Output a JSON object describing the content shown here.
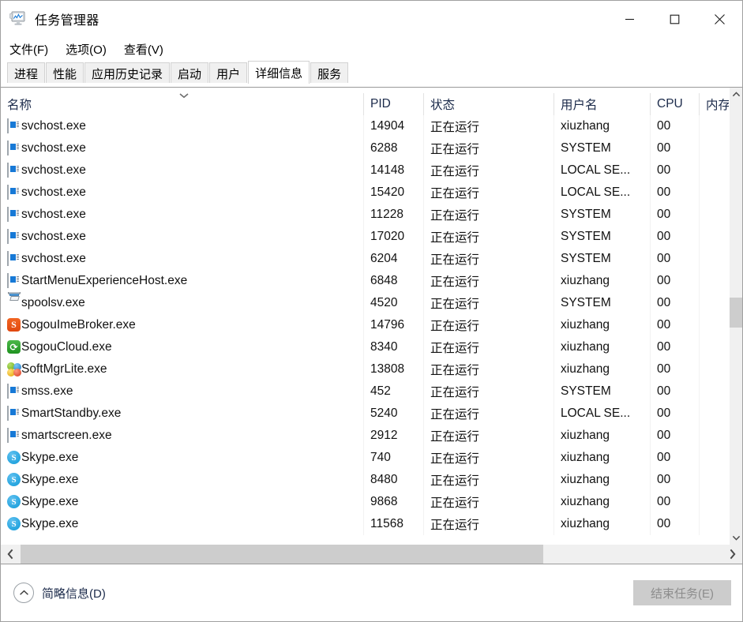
{
  "window": {
    "title": "任务管理器",
    "icon": "task-manager-icon",
    "minimize": "—",
    "maximize": "▢",
    "close": "✕"
  },
  "menu": {
    "items": [
      {
        "label": "文件(F)",
        "accel": "F"
      },
      {
        "label": "选项(O)",
        "accel": "O"
      },
      {
        "label": "查看(V)",
        "accel": "V"
      }
    ]
  },
  "tabs": {
    "active": "详细信息",
    "items": [
      {
        "label": "进程"
      },
      {
        "label": "性能"
      },
      {
        "label": "应用历史记录"
      },
      {
        "label": "启动"
      },
      {
        "label": "用户"
      },
      {
        "label": "详细信息"
      },
      {
        "label": "服务"
      }
    ]
  },
  "table": {
    "sort_column": "名称",
    "sort_direction": "descending",
    "sort_indicator": "chevron-down",
    "columns": [
      {
        "key": "name",
        "label": "名称"
      },
      {
        "key": "pid",
        "label": "PID"
      },
      {
        "key": "status",
        "label": "状态"
      },
      {
        "key": "user",
        "label": "用户名"
      },
      {
        "key": "cpu",
        "label": "CPU"
      },
      {
        "key": "mem",
        "label": "内存"
      }
    ],
    "rows": [
      {
        "icon": "generic-app-icon",
        "name": "svchost.exe",
        "pid": "14904",
        "status": "正在运行",
        "user": "xiuzhang",
        "cpu": "00",
        "mem": ""
      },
      {
        "icon": "generic-app-icon",
        "name": "svchost.exe",
        "pid": "6288",
        "status": "正在运行",
        "user": "SYSTEM",
        "cpu": "00",
        "mem": ""
      },
      {
        "icon": "generic-app-icon",
        "name": "svchost.exe",
        "pid": "14148",
        "status": "正在运行",
        "user": "LOCAL SE...",
        "cpu": "00",
        "mem": ""
      },
      {
        "icon": "generic-app-icon",
        "name": "svchost.exe",
        "pid": "15420",
        "status": "正在运行",
        "user": "LOCAL SE...",
        "cpu": "00",
        "mem": ""
      },
      {
        "icon": "generic-app-icon",
        "name": "svchost.exe",
        "pid": "11228",
        "status": "正在运行",
        "user": "SYSTEM",
        "cpu": "00",
        "mem": ""
      },
      {
        "icon": "generic-app-icon",
        "name": "svchost.exe",
        "pid": "17020",
        "status": "正在运行",
        "user": "SYSTEM",
        "cpu": "00",
        "mem": ""
      },
      {
        "icon": "generic-app-icon",
        "name": "svchost.exe",
        "pid": "6204",
        "status": "正在运行",
        "user": "SYSTEM",
        "cpu": "00",
        "mem": ""
      },
      {
        "icon": "generic-app-icon",
        "name": "StartMenuExperienceHost.exe",
        "pid": "6848",
        "status": "正在运行",
        "user": "xiuzhang",
        "cpu": "00",
        "mem": ""
      },
      {
        "icon": "printer-icon",
        "name": "spoolsv.exe",
        "pid": "4520",
        "status": "正在运行",
        "user": "SYSTEM",
        "cpu": "00",
        "mem": ""
      },
      {
        "icon": "sogou-ime-icon",
        "name": "SogouImeBroker.exe",
        "pid": "14796",
        "status": "正在运行",
        "user": "xiuzhang",
        "cpu": "00",
        "mem": ""
      },
      {
        "icon": "sogou-cloud-icon",
        "name": "SogouCloud.exe",
        "pid": "8340",
        "status": "正在运行",
        "user": "xiuzhang",
        "cpu": "00",
        "mem": ""
      },
      {
        "icon": "soft-mgr-icon",
        "name": "SoftMgrLite.exe",
        "pid": "13808",
        "status": "正在运行",
        "user": "xiuzhang",
        "cpu": "00",
        "mem": ""
      },
      {
        "icon": "generic-app-icon",
        "name": "smss.exe",
        "pid": "452",
        "status": "正在运行",
        "user": "SYSTEM",
        "cpu": "00",
        "mem": ""
      },
      {
        "icon": "generic-app-icon",
        "name": "SmartStandby.exe",
        "pid": "5240",
        "status": "正在运行",
        "user": "LOCAL SE...",
        "cpu": "00",
        "mem": ""
      },
      {
        "icon": "generic-app-icon",
        "name": "smartscreen.exe",
        "pid": "2912",
        "status": "正在运行",
        "user": "xiuzhang",
        "cpu": "00",
        "mem": ""
      },
      {
        "icon": "skype-icon",
        "name": "Skype.exe",
        "pid": "740",
        "status": "正在运行",
        "user": "xiuzhang",
        "cpu": "00",
        "mem": ""
      },
      {
        "icon": "skype-icon",
        "name": "Skype.exe",
        "pid": "8480",
        "status": "正在运行",
        "user": "xiuzhang",
        "cpu": "00",
        "mem": ""
      },
      {
        "icon": "skype-icon",
        "name": "Skype.exe",
        "pid": "9868",
        "status": "正在运行",
        "user": "xiuzhang",
        "cpu": "00",
        "mem": ""
      },
      {
        "icon": "skype-icon",
        "name": "Skype.exe",
        "pid": "11568",
        "status": "正在运行",
        "user": "xiuzhang",
        "cpu": "00",
        "mem": ""
      }
    ]
  },
  "scrollbars": {
    "vertical_up": "⌃",
    "vertical_down": "⌄",
    "horizontal_left": "❮",
    "horizontal_right": "❯"
  },
  "footer": {
    "fewer_details_label": "简略信息(D)",
    "fewer_details_icon": "chevron-up-circle-icon",
    "end_task_label": "结束任务(E)",
    "end_task_enabled": false
  }
}
